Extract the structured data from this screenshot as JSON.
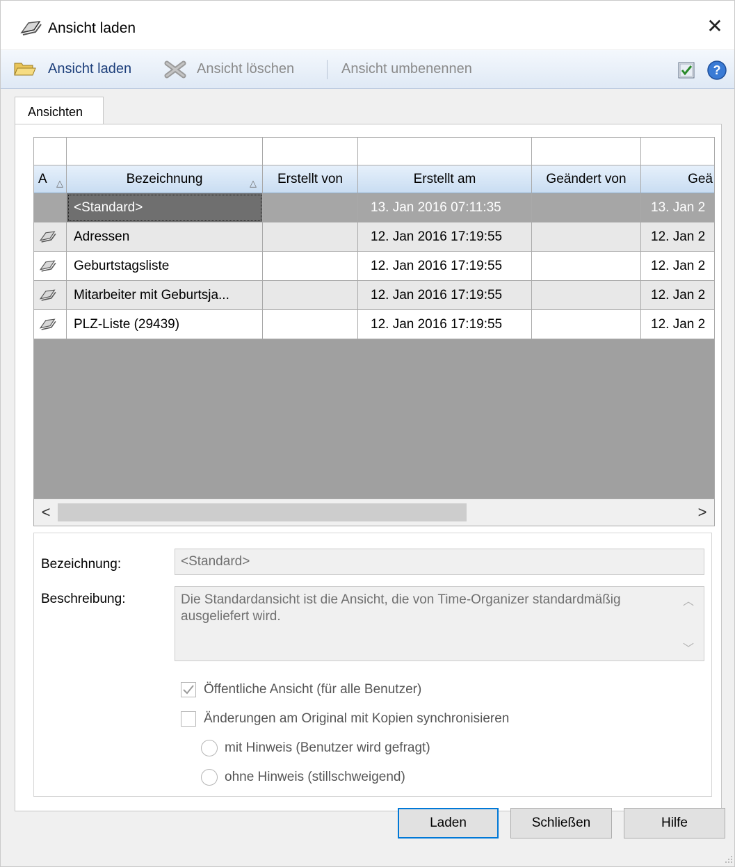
{
  "window": {
    "title": "Ansicht laden",
    "close_glyph": "✕"
  },
  "toolbar": {
    "load_label": "Ansicht laden",
    "delete_label": "Ansicht löschen",
    "rename_label": "Ansicht umbenennen"
  },
  "tab": {
    "label": "Ansichten"
  },
  "grid": {
    "columns": [
      "A",
      "Bezeichnung",
      "Erstellt von",
      "Erstellt am",
      "Geändert von",
      "Geä"
    ],
    "rows": [
      {
        "name": "<Standard>",
        "created_by": "",
        "created_at": "13. Jan 2016 07:11:35",
        "changed_by": "",
        "changed_at": "13. Jan 2",
        "icon": "view-icon",
        "selected": true
      },
      {
        "name": "Adressen",
        "created_by": "",
        "created_at": "12. Jan 2016 17:19:55",
        "changed_by": "",
        "changed_at": "12. Jan 2",
        "icon": "view-icon"
      },
      {
        "name": "Geburtstagsliste",
        "created_by": "",
        "created_at": "12. Jan 2016 17:19:55",
        "changed_by": "",
        "changed_at": "12. Jan 2",
        "icon": "view-icon"
      },
      {
        "name": "Mitarbeiter mit Geburtsja...",
        "created_by": "",
        "created_at": "12. Jan 2016 17:19:55",
        "changed_by": "",
        "changed_at": "12. Jan 2",
        "icon": "view-icon"
      },
      {
        "name": "PLZ-Liste (29439)",
        "created_by": "",
        "created_at": "12. Jan 2016 17:19:55",
        "changed_by": "",
        "changed_at": "12. Jan 2",
        "icon": "view-icon"
      }
    ],
    "scroll_left": "<",
    "scroll_right": ">"
  },
  "details": {
    "name_label": "Bezeichnung:",
    "name_value": "<Standard>",
    "desc_label": "Beschreibung:",
    "desc_value": "Die Standardansicht ist die Ansicht, die von Time-Organizer standardmäßig ausgeliefert wird.",
    "public_label": "Öffentliche Ansicht (für alle Benutzer)",
    "public_checked": true,
    "sync_label": "Änderungen am Original mit Kopien synchronisieren",
    "sync_checked": false,
    "radio_notify": "mit Hinweis (Benutzer wird gefragt)",
    "radio_silent": "ohne Hinweis (stillschweigend)"
  },
  "buttons": {
    "load": "Laden",
    "close": "Schließen",
    "help": "Hilfe"
  },
  "colors": {
    "accent": "#0078d7",
    "toolbar_text": "#1c3e7a",
    "selected_row": "#a6a6a6"
  }
}
